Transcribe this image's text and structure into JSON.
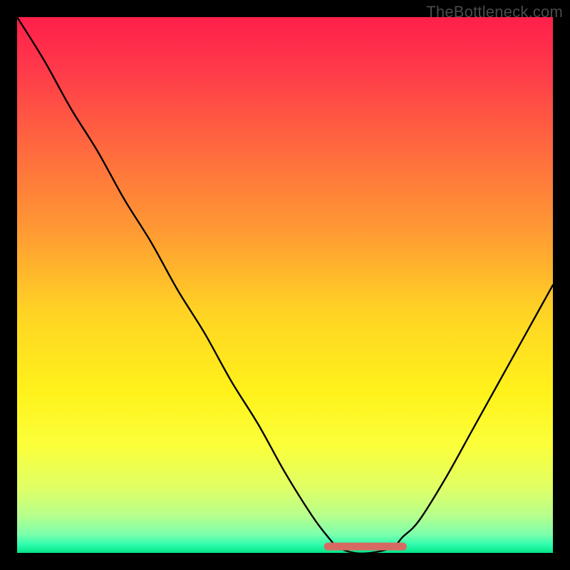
{
  "watermark": "TheBottleneck.com",
  "chart_data": {
    "type": "line",
    "title": "",
    "xlabel": "",
    "ylabel": "",
    "x_range": [
      0,
      100
    ],
    "y_range": [
      0,
      100
    ],
    "series": [
      {
        "name": "bottleneck-curve",
        "x": [
          0,
          5,
          10,
          15,
          20,
          25,
          30,
          35,
          40,
          45,
          50,
          55,
          58,
          60,
          63,
          66,
          70,
          72,
          75,
          80,
          85,
          90,
          95,
          100
        ],
        "y": [
          100,
          92,
          83,
          75,
          66,
          58,
          49,
          41,
          32,
          24,
          15,
          7,
          3,
          1,
          0,
          0,
          1,
          3,
          6,
          14,
          23,
          32,
          41,
          50
        ]
      },
      {
        "name": "optimal-band",
        "x": [
          58,
          72
        ],
        "y": [
          1.2,
          1.2
        ]
      }
    ],
    "background_gradient": {
      "stops": [
        {
          "pos": 0.0,
          "color": "#ff1f4b"
        },
        {
          "pos": 0.1,
          "color": "#ff3a4a"
        },
        {
          "pos": 0.25,
          "color": "#ff6b3e"
        },
        {
          "pos": 0.4,
          "color": "#ff9a33"
        },
        {
          "pos": 0.55,
          "color": "#ffd324"
        },
        {
          "pos": 0.7,
          "color": "#fff21b"
        },
        {
          "pos": 0.8,
          "color": "#fbff3a"
        },
        {
          "pos": 0.88,
          "color": "#dfff66"
        },
        {
          "pos": 0.93,
          "color": "#b7ff8c"
        },
        {
          "pos": 0.965,
          "color": "#7dffab"
        },
        {
          "pos": 0.985,
          "color": "#2dfcad"
        },
        {
          "pos": 1.0,
          "color": "#03e586"
        }
      ]
    },
    "curve_color": "#000000",
    "band_color": "#d66a63"
  }
}
